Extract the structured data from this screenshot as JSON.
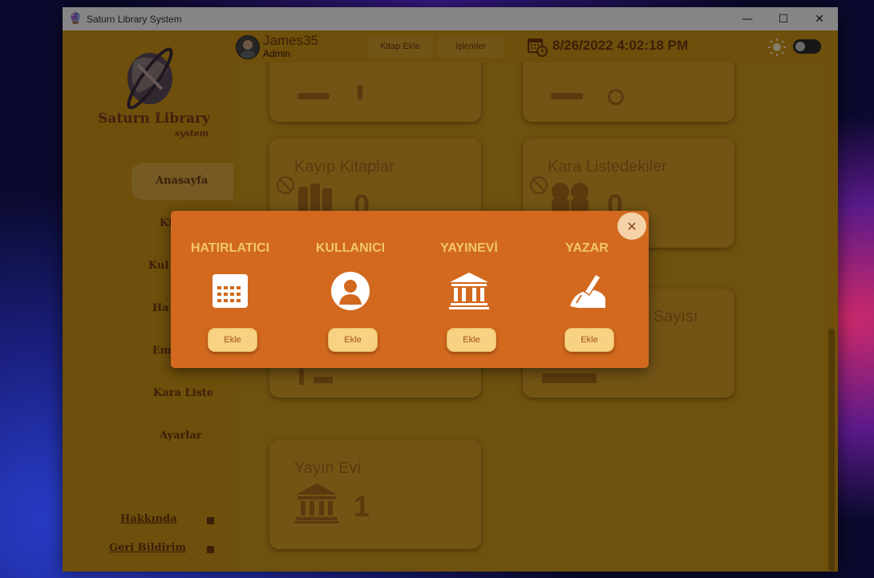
{
  "window": {
    "title": "Saturn Library System",
    "controls": {
      "minimize": "—",
      "maximize": "☐",
      "close": "✕"
    }
  },
  "sidebar": {
    "brand": "Saturn Library",
    "brand_sub": "system",
    "items": [
      {
        "label": "Anasayfa",
        "active": true
      },
      {
        "label": "Ki"
      },
      {
        "label": "Kul"
      },
      {
        "label": "Ha"
      },
      {
        "label": "Em"
      },
      {
        "label": "Kara Liste"
      },
      {
        "label": "Ayarlar"
      }
    ],
    "bottom_links": [
      {
        "label": "Hakkında"
      },
      {
        "label": "Geri Bildirim"
      }
    ]
  },
  "header": {
    "user_name": "James35",
    "user_role": "Admin",
    "buttons": [
      "Kitap Ekle",
      "İşlemler"
    ],
    "datetime": "8/26/2022 4:02:18 PM",
    "icons": {
      "calendar": "calendar-clock-icon",
      "theme": "sun-icon"
    }
  },
  "cards": [
    {
      "title": "",
      "value": ""
    },
    {
      "title": "",
      "value": ""
    },
    {
      "title": "Kayıp Kitaplar",
      "value": "0",
      "icon": "books-icon"
    },
    {
      "title": "Kara Listedekiler",
      "value": "0",
      "icon": "users-icon"
    },
    {
      "title": "",
      "value": ""
    },
    {
      "title": "ıncı Sayısı",
      "value": ""
    },
    {
      "title": "Yayın Evi",
      "value": "1",
      "icon": "bank-icon"
    }
  ],
  "modal": {
    "columns": [
      {
        "title": "HATIRLATICI",
        "icon": "calendar-icon",
        "button": "Ekle"
      },
      {
        "title": "KULLANICI",
        "icon": "user-icon",
        "button": "Ekle"
      },
      {
        "title": "YAYINEVİ",
        "icon": "bank-icon",
        "button": "Ekle"
      },
      {
        "title": "YAZAR",
        "icon": "pen-hand-icon",
        "button": "Ekle"
      }
    ],
    "close": "✕"
  },
  "colors": {
    "accent": "#d2691e",
    "sidebar": "#c99115",
    "text_dark": "#6e3a12",
    "modal_title": "#f2c766",
    "ekle_button": "#f7d283"
  }
}
